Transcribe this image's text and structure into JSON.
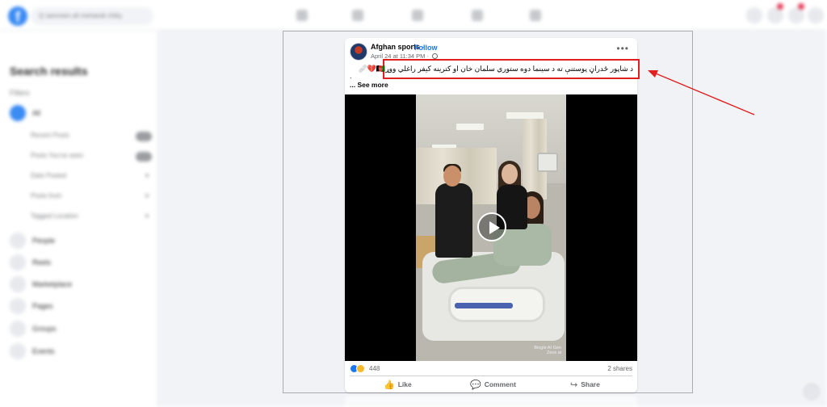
{
  "background": {
    "search_placeholder": "Q  samreen ali mehandi chiky",
    "sidebar_title": "Search results",
    "filters_label": "Filters",
    "sidebar_items": [
      "All",
      "Recent Posts",
      "Posts You've seen",
      "Date Posted",
      "Posts from",
      "Tagged Location",
      "People",
      "Reels",
      "Marketplace",
      "Pages",
      "Groups",
      "Events"
    ]
  },
  "post": {
    "page_name": "Afghan sports",
    "separator": " · ",
    "follow_label": "Follow",
    "timestamp": "April 24 at 11:34 PM · ",
    "more_label": "•••",
    "text": "د شاپور ځدراڼ پوستنې ته د سینما دوه ستوري سلمان خان او کترینه کيفر راغلي ووړ🇦🇫💔🩹",
    "period": ".",
    "see_more": "... See more",
    "video_watermark_line1": "Bingle AI Gen",
    "video_watermark_line2": "Zeus ai",
    "reaction_count": "448",
    "shares_label": "2 shares",
    "actions": {
      "like": "Like",
      "comment": "Comment",
      "share": "Share"
    }
  },
  "icons": {
    "like": "thumbs-up-icon",
    "comment": "speech-bubble-icon",
    "share": "share-arrow-icon",
    "more": "ellipsis-icon",
    "privacy": "globe-icon",
    "play": "play-icon"
  },
  "colors": {
    "highlight_box": "#e02020",
    "arrow": "#e02020",
    "facebook_blue": "#1877f2"
  }
}
